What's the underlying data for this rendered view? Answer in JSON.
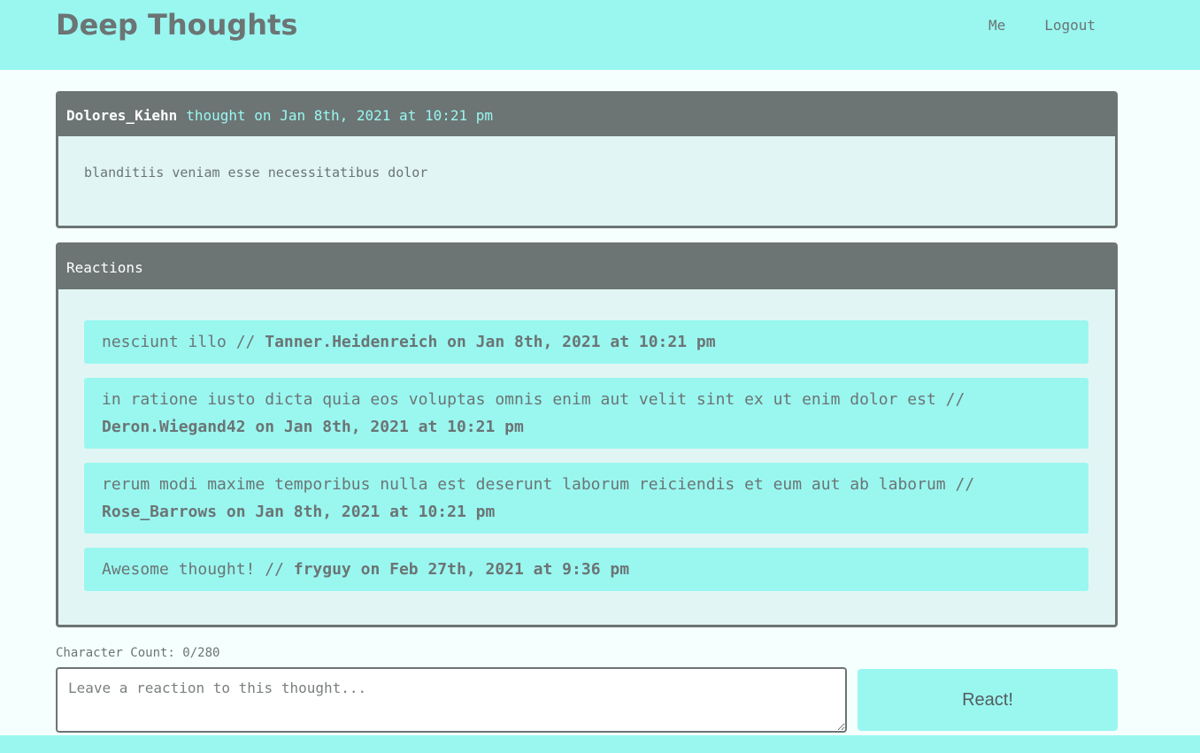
{
  "header": {
    "title": "Deep Thoughts",
    "nav": [
      {
        "label": "Me"
      },
      {
        "label": "Logout"
      }
    ]
  },
  "thought": {
    "username": "Dolores_Kiehn",
    "meta": "thought on Jan 8th, 2021 at 10:21 pm",
    "text": "blanditiis veniam esse necessitatibus dolor"
  },
  "reactions": {
    "title": "Reactions",
    "items": [
      {
        "body": "nesciunt illo // ",
        "byline": "Tanner.Heidenreich on Jan 8th, 2021 at 10:21 pm"
      },
      {
        "body": "in ratione iusto dicta quia eos voluptas omnis enim aut velit sint ex ut enim dolor est // ",
        "byline": "Deron.Wiegand42 on Jan 8th, 2021 at 10:21 pm"
      },
      {
        "body": "rerum modi maxime temporibus nulla est deserunt laborum reiciendis et eum aut ab laborum // ",
        "byline": "Rose_Barrows on Jan 8th, 2021 at 10:21 pm"
      },
      {
        "body": "Awesome thought! // ",
        "byline": "fryguy on Feb 27th, 2021 at 9:36 pm"
      }
    ]
  },
  "form": {
    "char_count": "Character Count: 0/280",
    "placeholder": "Leave a reaction to this thought...",
    "value": "",
    "submit_label": "React!"
  },
  "colors": {
    "accent": "#99f7f0",
    "dark": "#6c7474",
    "card_bg": "#e1f6f4",
    "page_bg": "#f5fffe"
  }
}
